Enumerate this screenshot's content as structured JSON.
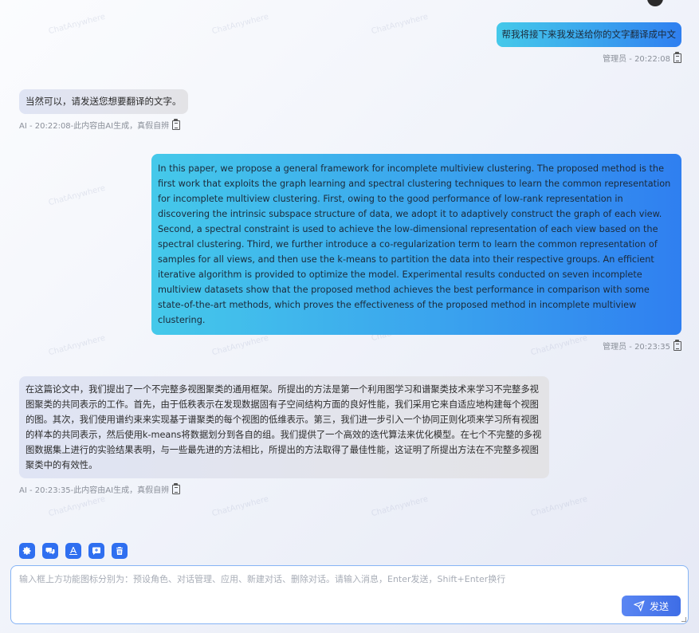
{
  "watermark": "ChatAnywhere",
  "messages": [
    {
      "role": "user",
      "text": "帮我将接下来我发送给你的文字翻译成中文",
      "meta": "管理员 - 20:22:08"
    },
    {
      "role": "ai",
      "text": "当然可以，请发送您想要翻译的文字。",
      "meta": "AI - 20:22:08-此内容由AI生成，真假自辨"
    },
    {
      "role": "user",
      "text": "In this paper, we propose a general framework for incomplete multiview clustering. The proposed method is the first work that exploits the graph learning and spectral clustering techniques to learn the common representation for incomplete multiview clustering. First, owing to the good performance of low-rank representation in discovering the intrinsic subspace structure of data, we adopt it to adaptively construct the graph of each view. Second, a spectral constraint is used to achieve the low-dimensional representation of each view based on the spectral clustering. Third, we further introduce a co-regularization term to learn the common representation of samples for all views, and then use the k-means to partition the data into their respective groups. An efficient iterative algorithm is provided to optimize the model. Experimental results conducted on seven incomplete multiview datasets show that the proposed method achieves the best performance in comparison with some state-of-the-art methods, which proves the effectiveness of the proposed method in incomplete multiview clustering.",
      "meta": "管理员 - 20:23:35"
    },
    {
      "role": "ai",
      "text": "在这篇论文中，我们提出了一个不完整多视图聚类的通用框架。所提出的方法是第一个利用图学习和谱聚类技术来学习不完整多视图聚类的共同表示的工作。首先，由于低秩表示在发现数据固有子空间结构方面的良好性能，我们采用它来自适应地构建每个视图的图。其次，我们使用谱约束来实现基于谱聚类的每个视图的低维表示。第三，我们进一步引入一个协同正则化项来学习所有视图的样本的共同表示，然后使用k-means将数据划分到各自的组。我们提供了一个高效的迭代算法来优化模型。在七个不完整的多视图数据集上进行的实验结果表明，与一些最先进的方法相比，所提出的方法取得了最佳性能，这证明了所提出方法在不完整多视图聚类中的有效性。",
      "meta": "AI - 20:23:35-此内容由AI生成，真假自辨"
    }
  ],
  "toolbar": {
    "icons": [
      "gear-icon",
      "chat-manage-icon",
      "app-icon",
      "new-chat-icon",
      "delete-icon"
    ]
  },
  "input": {
    "placeholder": "输入框上方功能图标分别为：预设角色、对话管理、应用、新建对话、删除对话。请输入消息，Enter发送，Shift+Enter换行",
    "send_label": "发送"
  },
  "colors": {
    "accent": "#2f6ff0",
    "user_bubble_start": "#45c9ea",
    "user_bubble_end": "#2f7ff0",
    "ai_bubble": "#e2e4ee"
  }
}
